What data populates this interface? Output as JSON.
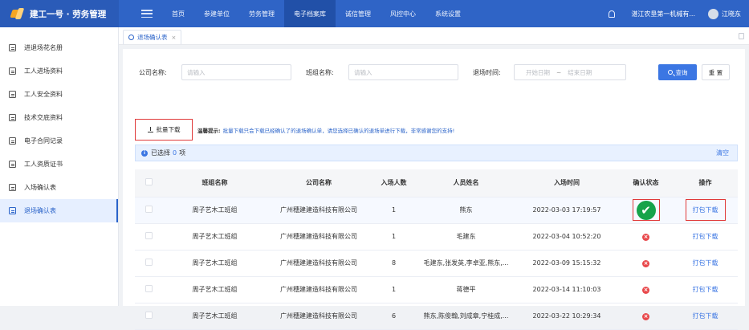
{
  "app": {
    "title": "建工一号 · 劳务管理"
  },
  "topnav": {
    "items": [
      "首页",
      "参建单位",
      "劳务管理",
      "电子档案库",
      "诚信管理",
      "风控中心",
      "系统设置"
    ],
    "active_index": 3
  },
  "topright": {
    "company": "湛江农垦第一机械有...",
    "user": "江晓东"
  },
  "sidebar": {
    "items": [
      "进退场花名册",
      "工人进场资料",
      "工人安全资料",
      "技术交底资料",
      "电子合同记录",
      "工人资质证书",
      "入场确认表",
      "退场确认表"
    ],
    "active_index": 7
  },
  "tabs": [
    {
      "label": "退场确认表",
      "close": "×"
    }
  ],
  "filters": {
    "company_label": "公司名称:",
    "company_placeholder": "请输入",
    "team_label": "班组名称:",
    "team_placeholder": "请输入",
    "time_label": "退场时间:",
    "start_placeholder": "开始日期",
    "date_sep": "~",
    "end_placeholder": "结束日期",
    "query_label": "查询",
    "reset_label": "重 置"
  },
  "toolbar": {
    "batch_download": "批量下载",
    "tip_label": "温馨提示:",
    "tip_text": "批量下载只会下载已经确认了的退场确认单，请您选择已确认的退场单进行下载，非常感谢您的支持!"
  },
  "selection": {
    "prefix": "已选择",
    "count": "0",
    "suffix": "项",
    "clear": "清空"
  },
  "table": {
    "columns": [
      "",
      "班组名称",
      "公司名称",
      "入场人数",
      "人员姓名",
      "入场时间",
      "确认状态",
      "操作"
    ],
    "rows": [
      {
        "team": "周子艺木工班组",
        "company": "广州穗建建造科技有限公司",
        "count": "1",
        "names": "熊东",
        "time": "2022-03-03 17:19:57",
        "status": "confirmed",
        "action": "打包下载"
      },
      {
        "team": "周子艺木工班组",
        "company": "广州穗建建造科技有限公司",
        "count": "1",
        "names": "毛建东",
        "time": "2022-03-04 10:52:20",
        "status": "unconfirmed",
        "action": "打包下载"
      },
      {
        "team": "周子艺木工班组",
        "company": "广州穗建建造科技有限公司",
        "count": "8",
        "names": "毛建东,张发英,李卓亚,熊东,...",
        "time": "2022-03-09 15:15:32",
        "status": "unconfirmed",
        "action": "打包下载"
      },
      {
        "team": "周子艺木工班组",
        "company": "广州穗建建造科技有限公司",
        "count": "1",
        "names": "蒋德平",
        "time": "2022-03-14 11:10:03",
        "status": "unconfirmed",
        "action": "打包下载"
      },
      {
        "team": "周子艺木工班组",
        "company": "广州穗建建造科技有限公司",
        "count": "6",
        "names": "熊东,陈俊翰,刘成章,宁桂成,...",
        "time": "2022-03-22 10:29:34",
        "status": "unconfirmed",
        "action": "打包下载"
      }
    ]
  },
  "colors": {
    "primary": "#2f64c6",
    "accent": "#3b76e3",
    "highlight_border": "#e03a3a",
    "confirmed": "#16a34a",
    "unconfirmed": "#e8474a"
  }
}
